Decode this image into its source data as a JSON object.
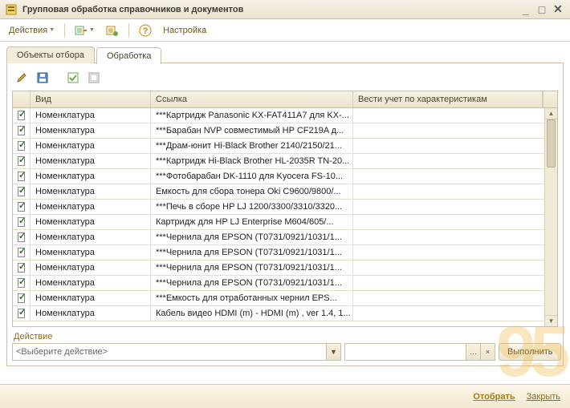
{
  "window": {
    "title": "Групповая обработка справочников и документов"
  },
  "toolbar": {
    "actions": "Действия",
    "settings": "Настройка"
  },
  "tabs": {
    "selection": "Объекты отбора",
    "processing": "Обработка"
  },
  "grid": {
    "headers": {
      "kind": "Вид",
      "link": "Ссылка",
      "char": "Вести учет по характеристикам"
    },
    "rows": [
      {
        "checked": true,
        "kind": "Номенклатура",
        "link": "***Картридж Panasonic KX-FAT411A7 для KX-..."
      },
      {
        "checked": true,
        "kind": "Номенклатура",
        "link": "***Барабан NVP совместимый HP CF219A д..."
      },
      {
        "checked": true,
        "kind": "Номенклатура",
        "link": "***Драм-юнит Hi-Black Brother 2140/2150/21..."
      },
      {
        "checked": true,
        "kind": "Номенклатура",
        "link": "***Картридж Hi-Black Brother HL-2035R TN-20..."
      },
      {
        "checked": true,
        "kind": "Номенклатура",
        "link": "***Фотобарабан DK-1110 для Kyocera  FS-10..."
      },
      {
        "checked": true,
        "kind": "Номенклатура",
        "link": "Емкость для сбора тонера Oki C9600/9800/..."
      },
      {
        "checked": true,
        "kind": "Номенклатура",
        "link": "***Печь в сборе HP LJ 1200/3300/3310/3320..."
      },
      {
        "checked": true,
        "kind": "Номенклатура",
        "link": "Картридж для HP LJ Enterprise M604/605/..."
      },
      {
        "checked": true,
        "kind": "Номенклатура",
        "link": "***Чернила для EPSON (T0731/0921/1031/1..."
      },
      {
        "checked": true,
        "kind": "Номенклатура",
        "link": "***Чернила для EPSON (T0731/0921/1031/1..."
      },
      {
        "checked": true,
        "kind": "Номенклатура",
        "link": "***Чернила для EPSON (T0731/0921/1031/1..."
      },
      {
        "checked": true,
        "kind": "Номенклатура",
        "link": "***Чернила для EPSON (T0731/0921/1031/1..."
      },
      {
        "checked": true,
        "kind": "Номенклатура",
        "link": "***Емкость для отработанных чернил EPS..."
      },
      {
        "checked": true,
        "kind": "Номенклатура",
        "link": "Кабель видео HDMI (m) - HDMI (m) , ver 1.4, 1..."
      }
    ]
  },
  "action": {
    "label": "Действие",
    "placeholder": "<Выберите действие>",
    "execute": "Выполнить"
  },
  "footer": {
    "select": "Отобрать",
    "close": "Закрыть"
  }
}
